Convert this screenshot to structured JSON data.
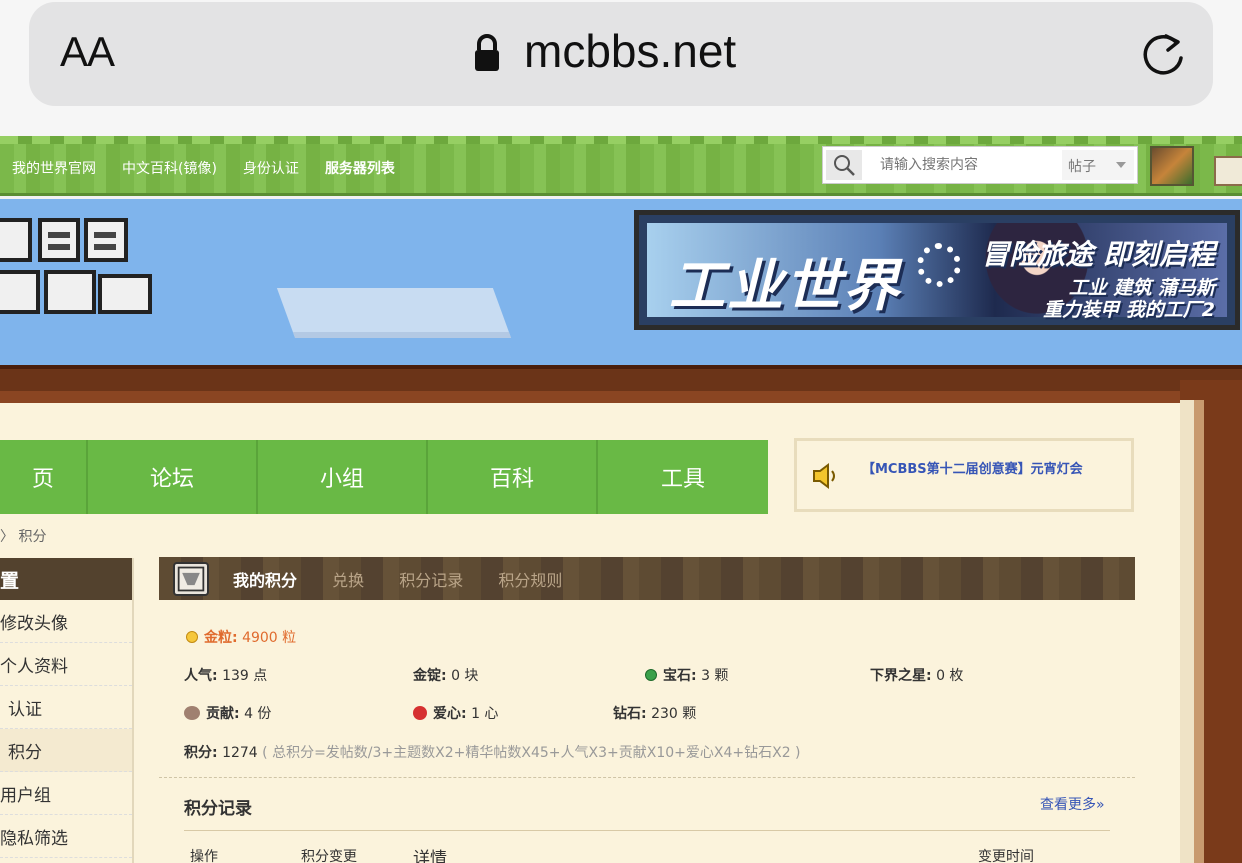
{
  "browser": {
    "aa_label": "AA",
    "domain": "mcbbs.net"
  },
  "topbar": {
    "links": [
      "我的世界官网",
      "中文百科(镜像)",
      "身份认证",
      "服务器列表"
    ],
    "search_placeholder": "请输入搜索内容",
    "search_type": "帖子"
  },
  "banner": {
    "title": "工业世界",
    "line1": "冒险旅途 即刻启程",
    "line2": "工业 建筑 蒲马斯",
    "line3": "重力装甲 我的工厂2"
  },
  "mainnav": {
    "items": [
      "页",
      "论坛",
      "小组",
      "百科",
      "工具"
    ]
  },
  "notice": {
    "text": "【MCBBS第十二届创意赛】元宵灯会"
  },
  "breadcrumb": {
    "sep": "〉",
    "current": "积分"
  },
  "sidebar": {
    "head": "置",
    "items": [
      "修改头像",
      "个人资料",
      "认证",
      "积分",
      "用户组",
      "隐私筛选"
    ]
  },
  "content": {
    "tabs": [
      "我的积分",
      "兑换",
      "积分记录",
      "积分规则"
    ],
    "gold": {
      "label": "金粒:",
      "value": "4900 粒"
    },
    "stats": {
      "popularity": {
        "label": "人气:",
        "value": "139 点"
      },
      "ingot": {
        "label": "金锭:",
        "value": "0 块"
      },
      "gem": {
        "label": "宝石:",
        "value": "3 颗"
      },
      "nether_star": {
        "label": "下界之星:",
        "value": "0 枚"
      },
      "contribution": {
        "label": "贡献:",
        "value": "4 份"
      },
      "love": {
        "label": "爱心:",
        "value": "1 心"
      },
      "diamond": {
        "label": "钻石:",
        "value": "230 颗"
      }
    },
    "total": {
      "label": "积分:",
      "value": "1274",
      "formula": "( 总积分=发帖数/3+主题数X2+精华帖数X45+人气X3+贡献X10+爱心X4+钻石X2 )"
    },
    "records": {
      "title": "积分记录",
      "more": "查看更多»",
      "columns": [
        "操作",
        "积分变更",
        "详情",
        "变更时间"
      ]
    }
  }
}
